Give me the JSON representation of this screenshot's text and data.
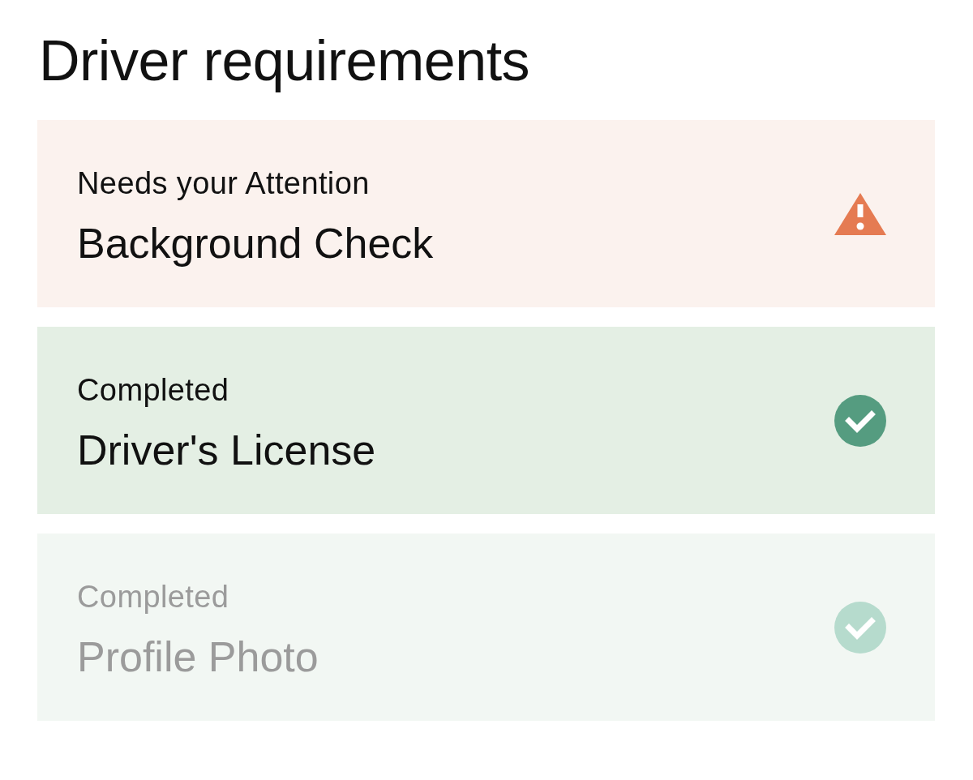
{
  "title": "Driver requirements",
  "requirements": [
    {
      "kind": "attention",
      "status": "Needs your Attention",
      "name": "Background Check",
      "disabled": false
    },
    {
      "kind": "completed",
      "status": "Completed",
      "name": "Driver's License",
      "disabled": false
    },
    {
      "kind": "completed",
      "status": "Completed",
      "name": "Profile Photo",
      "disabled": true
    }
  ]
}
